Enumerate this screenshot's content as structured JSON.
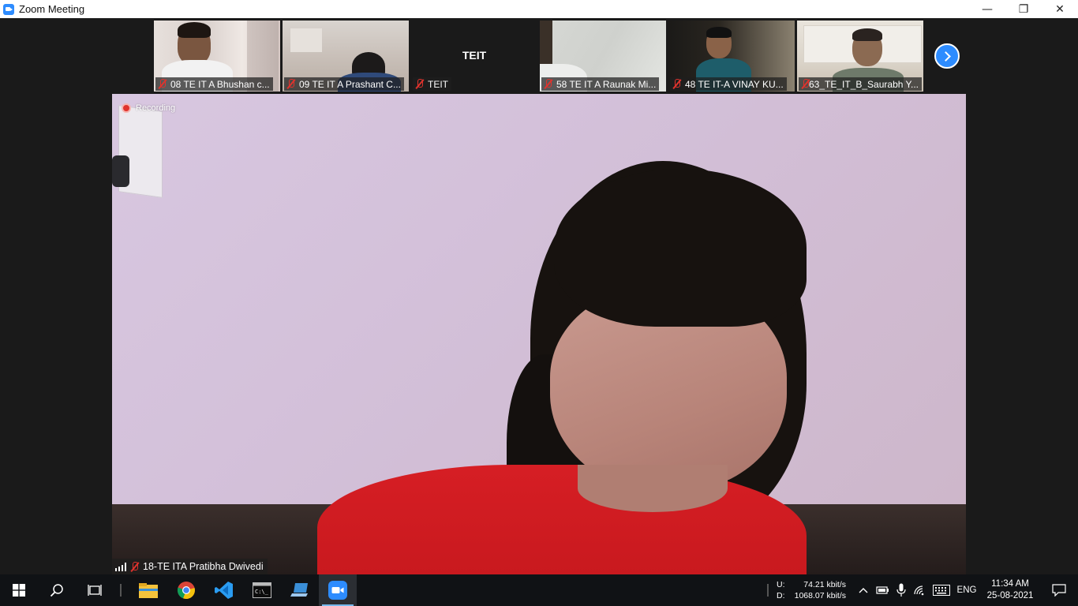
{
  "window": {
    "title": "Zoom Meeting",
    "controls": [
      "—",
      "❐",
      "✕"
    ]
  },
  "thumbnails": [
    {
      "name": "08 TE IT A Bhushan c...",
      "scene": "a"
    },
    {
      "name": "09 TE IT A Prashant C...",
      "scene": "b"
    },
    {
      "name": "TEIT",
      "big_name": "TEIT",
      "scene": "none"
    },
    {
      "name": "58 TE IT A Raunak Mi...",
      "scene": "c"
    },
    {
      "name": "48 TE IT-A VINAY KU...",
      "scene": "d"
    },
    {
      "name": "63_TE_IT_B_Saurabh Y...",
      "scene": "e"
    }
  ],
  "main_video": {
    "recording_label": "Recording",
    "speaker_name": "18-TE ITA Pratibha Dwivedi"
  },
  "taskbar": {
    "apps": [
      "start-icon",
      "search-icon",
      "task-view-icon",
      "file-explorer-icon",
      "chrome-icon",
      "vscode-icon",
      "terminal-icon",
      "laptop-app-icon",
      "zoom-icon"
    ],
    "network": {
      "up_label": "U:",
      "up_value": "74.21 kbit/s",
      "down_label": "D:",
      "down_value": "1068.07 kbit/s"
    },
    "language": "ENG",
    "time": "11:34 AM",
    "date": "25-08-2021"
  },
  "colors": {
    "zoom_blue": "#2d8cff",
    "mute_red": "#e0332d",
    "taskbar": "#101215"
  }
}
